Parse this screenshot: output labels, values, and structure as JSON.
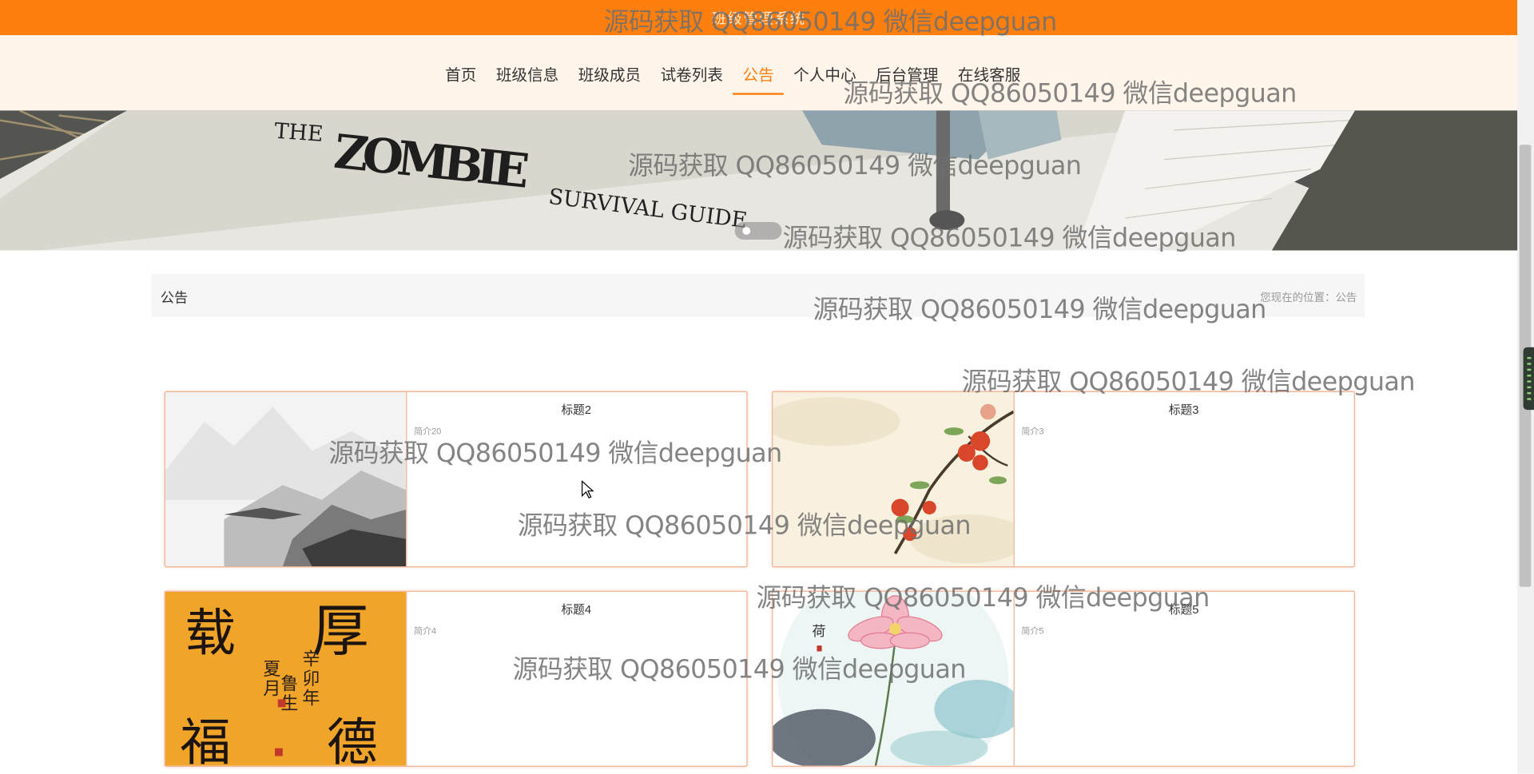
{
  "topbar": {
    "title": "班级管理系统"
  },
  "nav": {
    "items": [
      {
        "label": "首页"
      },
      {
        "label": "班级信息"
      },
      {
        "label": "班级成员"
      },
      {
        "label": "试卷列表"
      },
      {
        "label": "公告"
      },
      {
        "label": "个人中心"
      },
      {
        "label": "后台管理"
      },
      {
        "label": "在线客服"
      }
    ],
    "active": "公告"
  },
  "banner": {
    "book_title": "THE ZOMBIE SURVIVAL GUIDE"
  },
  "breadcrumb": {
    "title": "公告",
    "location_label": "您现在的位置：",
    "location_value": "公告"
  },
  "cards": [
    {
      "title": "标题2",
      "intro": "简介20",
      "image": "ink-landscape"
    },
    {
      "title": "标题3",
      "intro": "简介3",
      "image": "pomegranate-branch"
    },
    {
      "title": "标题4",
      "intro": "简介4",
      "image": "calligraphy"
    },
    {
      "title": "标题5",
      "intro": "简介5",
      "image": "lotus"
    }
  ],
  "watermark": "源码获取 QQ86050149 微信deepguan",
  "colors": {
    "primary": "#ff7f0e",
    "nav_bg": "#fff5ea",
    "card_border": "#f2b294"
  }
}
